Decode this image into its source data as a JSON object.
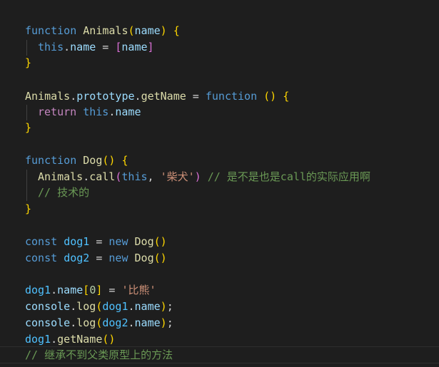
{
  "lines": {
    "l1": {
      "kw": "function",
      "name": "Animals",
      "open": "(",
      "param": "name",
      "close": ")",
      "brace": "{"
    },
    "l2": {
      "this": "this",
      "dot": ".",
      "prop": "name",
      "eq": " = ",
      "bopen": "[",
      "val": "name",
      "bclose": "]"
    },
    "l3": {
      "brace": "}"
    },
    "l4": {
      "obj": "Animals",
      "dot1": ".",
      "proto": "prototype",
      "dot2": ".",
      "method": "getName",
      "eq": " = ",
      "kw": "function",
      "parens": " ()",
      "brace": " {"
    },
    "l5": {
      "ret": "return",
      "this": "this",
      "dot": ".",
      "prop": "name"
    },
    "l6": {
      "brace": "}"
    },
    "l7": {
      "kw": "function",
      "name": "Dog",
      "parens": "()",
      "brace": " {"
    },
    "l8": {
      "obj": "Animals",
      "dot": ".",
      "method": "call",
      "open": "(",
      "this": "this",
      "comma": ", ",
      "str": "'柴犬'",
      "close": ")",
      "comment": " // 是不是也是call的实际应用啊"
    },
    "l9": {
      "comment": "// 技术的"
    },
    "l10": {
      "brace": "}"
    },
    "l11": {
      "kw": "const",
      "var": "dog1",
      "eq": " = ",
      "new": "new",
      "cls": "Dog",
      "parens": "()"
    },
    "l12": {
      "kw": "const",
      "var": "dog2",
      "eq": " = ",
      "new": "new",
      "cls": "Dog",
      "parens": "()"
    },
    "l13": {
      "var": "dog1",
      "dot": ".",
      "prop": "name",
      "bopen": "[",
      "num": "0",
      "bclose": "]",
      "eq": " = ",
      "str": "'比熊'"
    },
    "l14": {
      "obj": "console",
      "dot": ".",
      "method": "log",
      "open": "(",
      "var": "dog1",
      "dot2": ".",
      "prop": "name",
      "close": ")",
      "semi": ";"
    },
    "l15": {
      "obj": "console",
      "dot": ".",
      "method": "log",
      "open": "(",
      "var": "dog2",
      "dot2": ".",
      "prop": "name",
      "close": ")",
      "semi": ";"
    },
    "l16": {
      "var": "dog1",
      "dot": ".",
      "method": "getName",
      "parens": "()"
    },
    "l17": {
      "comment": "// 继承不到父类原型上的方法"
    }
  }
}
